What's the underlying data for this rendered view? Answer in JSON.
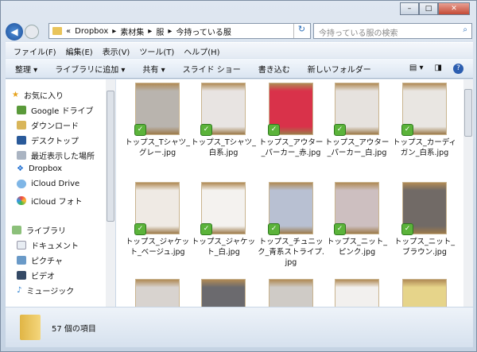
{
  "address": {
    "path": [
      "«",
      "Dropbox",
      "▸",
      "素材集",
      "▸",
      "服",
      "▸",
      "今持っている服"
    ]
  },
  "search": {
    "placeholder": "今持っている服の検索"
  },
  "menu": [
    "ファイル(F)",
    "編集(E)",
    "表示(V)",
    "ツール(T)",
    "ヘルプ(H)"
  ],
  "toolbar": [
    "整理 ▾",
    "ライブラリに追加 ▾",
    "共有 ▾",
    "スライド ショー",
    "書き込む",
    "新しいフォルダー"
  ],
  "sidebar": {
    "favorites_label": "お気に入り",
    "favorites": [
      "Google ドライブ",
      "ダウンロード",
      "デスクトップ",
      "最近表示した場所",
      "Dropbox",
      "iCloud Drive",
      "iCloud フォト"
    ],
    "libraries_label": "ライブラリ",
    "libraries": [
      "ドキュメント",
      "ピクチャ",
      "ビデオ",
      "ミュージック"
    ]
  },
  "files": [
    {
      "name": "トップス_Tシャツ_グレー.jpg",
      "color": "#b9b4ae"
    },
    {
      "name": "トップス_Tシャツ_白系.jpg",
      "color": "#e8e4e2"
    },
    {
      "name": "トップス_アウター_パーカー_赤.jpg",
      "color": "#d9324a"
    },
    {
      "name": "トップス_アウター_パーカー_白.jpg",
      "color": "#e6e2de"
    },
    {
      "name": "トップス_カーディガン_白系.jpg",
      "color": "#e9e6e2"
    },
    {
      "name": "トップス_ジャケット_ベージュ.jpg",
      "color": "#efeae4"
    },
    {
      "name": "トップス_ジャケット_白.jpg",
      "color": "#f4f2ef"
    },
    {
      "name": "トップス_チュニック_青系ストライプ.jpg",
      "color": "#b8c0d2"
    },
    {
      "name": "トップス_ニット_ピンク.jpg",
      "color": "#cdbfc0"
    },
    {
      "name": "トップス_ニット_ブラウン.jpg",
      "color": "#716a66"
    },
    {
      "name": "",
      "color": "#d8d3cf"
    },
    {
      "name": "",
      "color": "#6b6a6e"
    },
    {
      "name": "",
      "color": "#cfcbc6"
    },
    {
      "name": "",
      "color": "#f2f0ee"
    },
    {
      "name": "",
      "color": "#e6d48a"
    }
  ],
  "status": {
    "count": "57 個の項目"
  }
}
